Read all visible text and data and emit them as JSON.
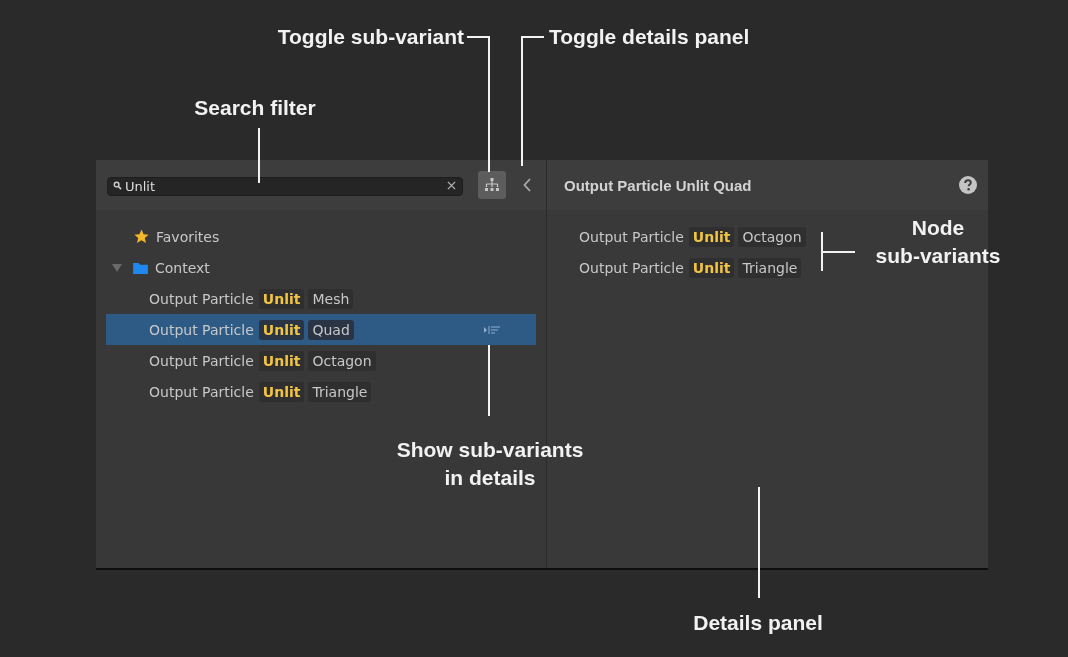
{
  "search": {
    "value": "Unlit"
  },
  "sub_variant_toggle": {
    "on": true
  },
  "tree": [
    {
      "kind": "favorites",
      "label": "Favorites"
    },
    {
      "kind": "folder",
      "label": "Context",
      "expanded": true,
      "children": [
        {
          "name": "Output Particle",
          "match": "Unlit",
          "variant": "Mesh",
          "selected": false
        },
        {
          "name": "Output Particle",
          "match": "Unlit",
          "variant": "Quad",
          "selected": true
        },
        {
          "name": "Output Particle",
          "match": "Unlit",
          "variant": "Octagon",
          "selected": false
        },
        {
          "name": "Output Particle",
          "match": "Unlit",
          "variant": "Triangle",
          "selected": false
        }
      ]
    }
  ],
  "details": {
    "title": "Output Particle Unlit Quad",
    "sub_variants": [
      {
        "name": "Output Particle",
        "match": "Unlit",
        "variant": "Octagon"
      },
      {
        "name": "Output Particle",
        "match": "Unlit",
        "variant": "Triangle"
      }
    ]
  },
  "callouts": [
    {
      "kind": "toggle-sub-variant",
      "lines": [
        "Toggle sub-variant"
      ]
    },
    {
      "kind": "toggle-details",
      "lines": [
        "Toggle details panel"
      ]
    },
    {
      "kind": "search-filter",
      "lines": [
        "Search filter"
      ]
    },
    {
      "kind": "node-sub-variants",
      "lines": [
        "Node",
        "sub-variants"
      ]
    },
    {
      "kind": "show-sub-variants",
      "lines": [
        "Show sub-variants",
        "in details"
      ]
    },
    {
      "kind": "details-panel",
      "lines": [
        "Details panel"
      ]
    }
  ]
}
